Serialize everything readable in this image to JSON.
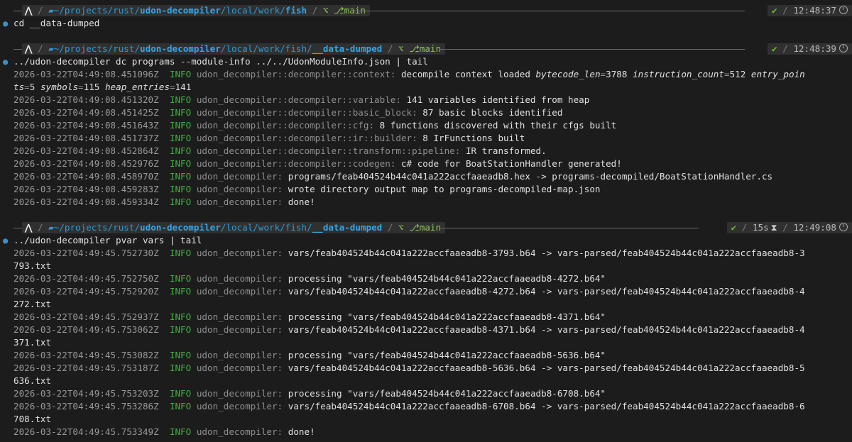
{
  "prompts": [
    {
      "arch_icon": "arch-linux-icon",
      "path_prefix": "~/projects/rust/",
      "path_bold": "udon-decompiler",
      "path_mid": "/local/work/",
      "path_last": "fish",
      "path_tail": "",
      "branch": "main",
      "status": "✔",
      "duration": "",
      "time": "12:48:37",
      "command": "cd __data-dumped"
    },
    {
      "arch_icon": "arch-linux-icon",
      "path_prefix": "~/projects/rust/",
      "path_bold": "udon-decompiler",
      "path_mid": "/local/work/fish/",
      "path_last": "__data-dumped",
      "branch": "main",
      "status": "✔",
      "duration": "",
      "time": "12:48:39",
      "command": "../udon-decompiler dc programs --module-info ../../UdonModuleInfo.json | tail"
    },
    {
      "arch_icon": "arch-linux-icon",
      "path_prefix": "~/projects/rust/",
      "path_bold": "udon-decompiler",
      "path_mid": "/local/work/fish/",
      "path_last": "__data-dumped",
      "branch": "main",
      "status": "✔",
      "duration": "15s",
      "time": "12:49:08",
      "command": "../udon-decompiler pvar vars | tail"
    }
  ],
  "log_block_1": {
    "context": {
      "ts": "2026-03-22T04:49:08.451096Z",
      "level": "INFO",
      "module": "udon_decompiler::decompiler::context:",
      "msg": "decompile context loaded",
      "k1": "bytecode_len",
      "v1": "3788",
      "k2": "instruction_count",
      "v2": "512",
      "k3a": "entry_poin",
      "k3b": "ts",
      "v3": "5",
      "k4": "symbols",
      "v4": "115",
      "k5": "heap_entries",
      "v5": "141"
    },
    "lines": [
      {
        "ts": "2026-03-22T04:49:08.451320Z",
        "level": "INFO",
        "module": "udon_decompiler::decompiler::variable:",
        "msg": "141 variables identified from heap"
      },
      {
        "ts": "2026-03-22T04:49:08.451425Z",
        "level": "INFO",
        "module": "udon_decompiler::decompiler::basic_block:",
        "msg": "87 basic blocks identified"
      },
      {
        "ts": "2026-03-22T04:49:08.451643Z",
        "level": "INFO",
        "module": "udon_decompiler::decompiler::cfg:",
        "msg": "8 functions discovered with their cfgs built"
      },
      {
        "ts": "2026-03-22T04:49:08.451737Z",
        "level": "INFO",
        "module": "udon_decompiler::decompiler::ir::builder:",
        "msg": "8 IrFunctions built"
      },
      {
        "ts": "2026-03-22T04:49:08.452864Z",
        "level": "INFO",
        "module": "udon_decompiler::decompiler::transform::pipeline:",
        "msg": "IR transformed."
      },
      {
        "ts": "2026-03-22T04:49:08.452976Z",
        "level": "INFO",
        "module": "udon_decompiler::decompiler::codegen:",
        "msg": "c# code for BoatStationHandler generated!"
      },
      {
        "ts": "2026-03-22T04:49:08.458970Z",
        "level": "INFO",
        "module": "udon_decompiler:",
        "msg": "programs/feab404524b44c041a222accfaaeadb8.hex -> programs-decompiled/BoatStationHandler.cs"
      },
      {
        "ts": "2026-03-22T04:49:08.459283Z",
        "level": "INFO",
        "module": "udon_decompiler:",
        "msg": "wrote directory output map to programs-decompiled-map.json"
      },
      {
        "ts": "2026-03-22T04:49:08.459334Z",
        "level": "INFO",
        "module": "udon_decompiler:",
        "msg": "done!"
      }
    ]
  },
  "log_block_2": {
    "lines": [
      {
        "ts": "2026-03-22T04:49:45.752730Z",
        "level": "INFO",
        "module": "udon_decompiler:",
        "msg": "vars/feab404524b44c041a222accfaaeadb8-3793.b64 -> vars-parsed/feab404524b44c041a222accfaaeadb8-3",
        "wrap": "793.txt"
      },
      {
        "ts": "2026-03-22T04:49:45.752750Z",
        "level": "INFO",
        "module": "udon_decompiler:",
        "msg": "processing \"vars/feab404524b44c041a222accfaaeadb8-4272.b64\"",
        "wrap": ""
      },
      {
        "ts": "2026-03-22T04:49:45.752920Z",
        "level": "INFO",
        "module": "udon_decompiler:",
        "msg": "vars/feab404524b44c041a222accfaaeadb8-4272.b64 -> vars-parsed/feab404524b44c041a222accfaaeadb8-4",
        "wrap": "272.txt"
      },
      {
        "ts": "2026-03-22T04:49:45.752937Z",
        "level": "INFO",
        "module": "udon_decompiler:",
        "msg": "processing \"vars/feab404524b44c041a222accfaaeadb8-4371.b64\"",
        "wrap": ""
      },
      {
        "ts": "2026-03-22T04:49:45.753062Z",
        "level": "INFO",
        "module": "udon_decompiler:",
        "msg": "vars/feab404524b44c041a222accfaaeadb8-4371.b64 -> vars-parsed/feab404524b44c041a222accfaaeadb8-4",
        "wrap": "371.txt"
      },
      {
        "ts": "2026-03-22T04:49:45.753082Z",
        "level": "INFO",
        "module": "udon_decompiler:",
        "msg": "processing \"vars/feab404524b44c041a222accfaaeadb8-5636.b64\"",
        "wrap": ""
      },
      {
        "ts": "2026-03-22T04:49:45.753187Z",
        "level": "INFO",
        "module": "udon_decompiler:",
        "msg": "vars/feab404524b44c041a222accfaaeadb8-5636.b64 -> vars-parsed/feab404524b44c041a222accfaaeadb8-5",
        "wrap": "636.txt"
      },
      {
        "ts": "2026-03-22T04:49:45.753203Z",
        "level": "INFO",
        "module": "udon_decompiler:",
        "msg": "processing \"vars/feab404524b44c041a222accfaaeadb8-6708.b64\"",
        "wrap": ""
      },
      {
        "ts": "2026-03-22T04:49:45.753286Z",
        "level": "INFO",
        "module": "udon_decompiler:",
        "msg": "vars/feab404524b44c041a222accfaaeadb8-6708.b64 -> vars-parsed/feab404524b44c041a222accfaaeadb8-6",
        "wrap": "708.txt"
      },
      {
        "ts": "2026-03-22T04:49:45.753349Z",
        "level": "INFO",
        "module": "udon_decompiler:",
        "msg": "done!",
        "wrap": ""
      }
    ]
  },
  "colors": {
    "background": "#1c1c1c",
    "path": "#2a9bd6",
    "git": "#8fc35a",
    "info": "#40b040",
    "ok": "#6fbe3a"
  }
}
